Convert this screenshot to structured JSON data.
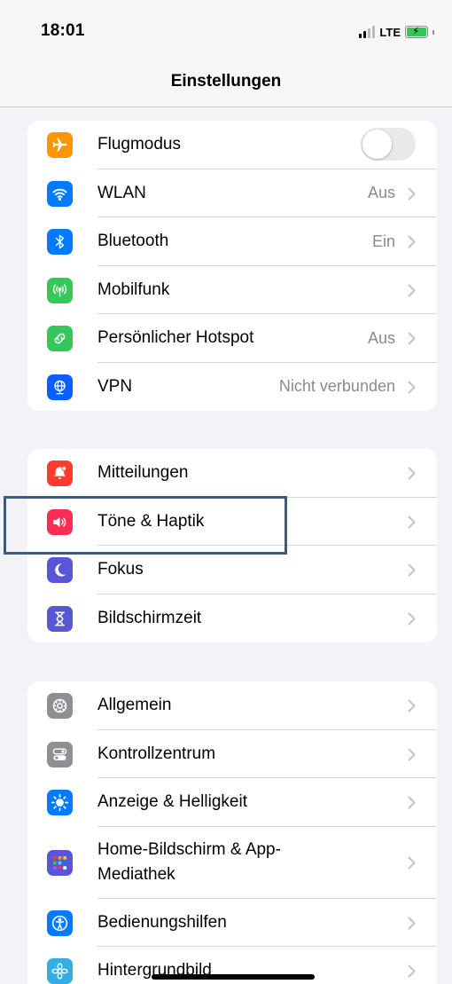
{
  "status_bar": {
    "time": "18:01",
    "network": "LTE"
  },
  "header": {
    "title": "Einstellungen"
  },
  "groups": [
    {
      "items": [
        {
          "label": "Flugmodus",
          "value": "",
          "icon": "airplane-icon",
          "color": "#ff9500",
          "toggle": "off"
        },
        {
          "label": "WLAN",
          "value": "Aus",
          "icon": "wifi-icon",
          "color": "#007aff"
        },
        {
          "label": "Bluetooth",
          "value": "Ein",
          "icon": "bluetooth-icon",
          "color": "#007aff"
        },
        {
          "label": "Mobilfunk",
          "value": "",
          "icon": "antenna-icon",
          "color": "#34c759"
        },
        {
          "label": "Persönlicher Hotspot",
          "value": "Aus",
          "icon": "hotspot-link-icon",
          "color": "#34c759"
        },
        {
          "label": "VPN",
          "value": "Nicht verbunden",
          "icon": "globe-icon",
          "color": "#0a60ff"
        }
      ]
    },
    {
      "items": [
        {
          "label": "Mitteilungen",
          "icon": "notification-bell-icon",
          "color": "#ff3b30"
        },
        {
          "label": "Töne & Haptik",
          "icon": "speaker-icon",
          "color": "#ff2d55"
        },
        {
          "label": "Fokus",
          "icon": "moon-icon",
          "color": "#5856d6"
        },
        {
          "label": "Bildschirmzeit",
          "icon": "hourglass-icon",
          "color": "#5856d6"
        }
      ]
    },
    {
      "items": [
        {
          "label": "Allgemein",
          "icon": "gear-icon",
          "color": "#8e8e93"
        },
        {
          "label": "Kontrollzentrum",
          "icon": "switches-icon",
          "color": "#8e8e93"
        },
        {
          "label": "Anzeige & Helligkeit",
          "icon": "sun-icon",
          "color": "#007aff"
        },
        {
          "label": "Home-Bildschirm & App-Mediathek",
          "icon": "app-grid-icon",
          "color": "#5856d6"
        },
        {
          "label": "Bedienungshilfen",
          "icon": "accessibility-icon",
          "color": "#007aff"
        },
        {
          "label": "Hintergrundbild",
          "icon": "flower-icon",
          "color": "#32ade6"
        }
      ]
    }
  ]
}
